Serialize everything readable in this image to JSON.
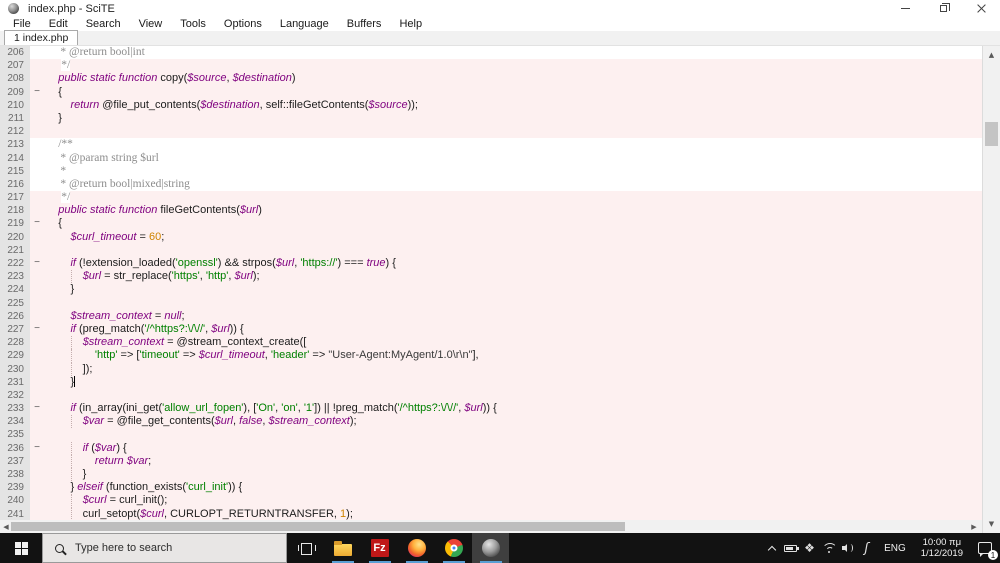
{
  "window": {
    "title": "index.php - SciTE"
  },
  "menu": [
    "File",
    "Edit",
    "Search",
    "View",
    "Tools",
    "Options",
    "Language",
    "Buffers",
    "Help"
  ],
  "tab": {
    "label": "1 index.php"
  },
  "editor": {
    "fold_char": "−",
    "lines": [
      {
        "n": 206,
        "bg": "c",
        "t": [
          [
            "cm",
            "     * @return bool|int"
          ]
        ]
      },
      {
        "n": 207,
        "t": [
          [
            "d",
            "     "
          ],
          [
            "cm",
            "*/"
          ]
        ]
      },
      {
        "n": 208,
        "t": [
          [
            "d",
            "    "
          ],
          [
            "k",
            "public"
          ],
          [
            "d",
            " "
          ],
          [
            "k",
            "static"
          ],
          [
            "d",
            " "
          ],
          [
            "k",
            "function"
          ],
          [
            "d",
            " copy("
          ],
          [
            "v",
            "$source"
          ],
          [
            "d",
            ", "
          ],
          [
            "v",
            "$destination"
          ],
          [
            "d",
            ")"
          ]
        ]
      },
      {
        "n": 209,
        "fold": true,
        "t": [
          [
            "d",
            "    {"
          ]
        ]
      },
      {
        "n": 210,
        "t": [
          [
            "d",
            "        "
          ],
          [
            "k",
            "return"
          ],
          [
            "d",
            " @file_put_contents("
          ],
          [
            "v",
            "$destination"
          ],
          [
            "d",
            ", self::fileGetContents("
          ],
          [
            "v",
            "$source"
          ],
          [
            "d",
            "));"
          ]
        ]
      },
      {
        "n": 211,
        "t": [
          [
            "d",
            "    }"
          ]
        ]
      },
      {
        "n": 212,
        "t": []
      },
      {
        "n": 213,
        "bg": "c",
        "t": [
          [
            "d",
            "    "
          ],
          [
            "cm",
            "/**"
          ]
        ]
      },
      {
        "n": 214,
        "bg": "c",
        "t": [
          [
            "cm",
            "     * @param string $url"
          ]
        ]
      },
      {
        "n": 215,
        "bg": "c",
        "t": [
          [
            "cm",
            "     *"
          ]
        ]
      },
      {
        "n": 216,
        "bg": "c",
        "t": [
          [
            "cm",
            "     * @return bool|mixed|string"
          ]
        ]
      },
      {
        "n": 217,
        "t": [
          [
            "d",
            "     "
          ],
          [
            "cm",
            "*/"
          ]
        ]
      },
      {
        "n": 218,
        "t": [
          [
            "d",
            "    "
          ],
          [
            "k",
            "public"
          ],
          [
            "d",
            " "
          ],
          [
            "k",
            "static"
          ],
          [
            "d",
            " "
          ],
          [
            "k",
            "function"
          ],
          [
            "d",
            " fileGetContents("
          ],
          [
            "v",
            "$url"
          ],
          [
            "d",
            ")"
          ]
        ]
      },
      {
        "n": 219,
        "fold": true,
        "t": [
          [
            "d",
            "    {"
          ]
        ]
      },
      {
        "n": 220,
        "t": [
          [
            "d",
            "        "
          ],
          [
            "v",
            "$curl_timeout"
          ],
          [
            "d",
            " = "
          ],
          [
            "n",
            "60"
          ],
          [
            "d",
            ";"
          ]
        ]
      },
      {
        "n": 221,
        "t": []
      },
      {
        "n": 222,
        "fold": true,
        "t": [
          [
            "d",
            "        "
          ],
          [
            "k",
            "if"
          ],
          [
            "d",
            " (!extension_loaded("
          ],
          [
            "s",
            "'openssl'"
          ],
          [
            "d",
            ") && strpos("
          ],
          [
            "v",
            "$url"
          ],
          [
            "d",
            ", "
          ],
          [
            "s",
            "'https://'"
          ],
          [
            "d",
            ") === "
          ],
          [
            "k",
            "true"
          ],
          [
            "d",
            ") {"
          ]
        ]
      },
      {
        "n": 223,
        "t": [
          [
            "d",
            "            "
          ],
          [
            "v",
            "$url"
          ],
          [
            "d",
            " = str_replace("
          ],
          [
            "s",
            "'https'"
          ],
          [
            "d",
            ", "
          ],
          [
            "s",
            "'http'"
          ],
          [
            "d",
            ", "
          ],
          [
            "v",
            "$url"
          ],
          [
            "d",
            ");"
          ]
        ]
      },
      {
        "n": 224,
        "t": [
          [
            "d",
            "        }"
          ]
        ]
      },
      {
        "n": 225,
        "t": []
      },
      {
        "n": 226,
        "t": [
          [
            "d",
            "        "
          ],
          [
            "v",
            "$stream_context"
          ],
          [
            "d",
            " = "
          ],
          [
            "k",
            "null"
          ],
          [
            "d",
            ";"
          ]
        ]
      },
      {
        "n": 227,
        "fold": true,
        "t": [
          [
            "d",
            "        "
          ],
          [
            "k",
            "if"
          ],
          [
            "d",
            " (preg_match("
          ],
          [
            "s",
            "'/^https?:\\/\\//'"
          ],
          [
            "d",
            ", "
          ],
          [
            "v",
            "$url"
          ],
          [
            "d",
            ")) {"
          ]
        ]
      },
      {
        "n": 228,
        "t": [
          [
            "d",
            "            "
          ],
          [
            "v",
            "$stream_context"
          ],
          [
            "d",
            " = @stream_context_create(["
          ]
        ]
      },
      {
        "n": 229,
        "t": [
          [
            "d",
            "                "
          ],
          [
            "s",
            "'http'"
          ],
          [
            "d",
            " => ["
          ],
          [
            "s",
            "'timeout'"
          ],
          [
            "d",
            " => "
          ],
          [
            "v",
            "$curl_timeout"
          ],
          [
            "d",
            ", "
          ],
          [
            "s",
            "'header'"
          ],
          [
            "d",
            " => "
          ],
          [
            "ds",
            "\"User-Agent:MyAgent/1.0\\r\\n\""
          ],
          [
            "d",
            "],"
          ]
        ]
      },
      {
        "n": 230,
        "t": [
          [
            "d",
            "            ]);"
          ]
        ]
      },
      {
        "n": 231,
        "caret": true,
        "t": [
          [
            "d",
            "        }"
          ]
        ]
      },
      {
        "n": 232,
        "t": []
      },
      {
        "n": 233,
        "fold": true,
        "t": [
          [
            "d",
            "        "
          ],
          [
            "k",
            "if"
          ],
          [
            "d",
            " (in_array(ini_get("
          ],
          [
            "s",
            "'allow_url_fopen'"
          ],
          [
            "d",
            "), ["
          ],
          [
            "s",
            "'On'"
          ],
          [
            "d",
            ", "
          ],
          [
            "s",
            "'on'"
          ],
          [
            "d",
            ", "
          ],
          [
            "s",
            "'1'"
          ],
          [
            "d",
            "]) || !preg_match("
          ],
          [
            "s",
            "'/^https?:\\/\\//'"
          ],
          [
            "d",
            ", "
          ],
          [
            "v",
            "$url"
          ],
          [
            "d",
            ")) {"
          ]
        ]
      },
      {
        "n": 234,
        "t": [
          [
            "d",
            "            "
          ],
          [
            "v",
            "$var"
          ],
          [
            "d",
            " = @file_get_contents("
          ],
          [
            "v",
            "$url"
          ],
          [
            "d",
            ", "
          ],
          [
            "k",
            "false"
          ],
          [
            "d",
            ", "
          ],
          [
            "v",
            "$stream_context"
          ],
          [
            "d",
            ");"
          ]
        ]
      },
      {
        "n": 235,
        "t": []
      },
      {
        "n": 236,
        "fold": true,
        "t": [
          [
            "d",
            "            "
          ],
          [
            "k",
            "if"
          ],
          [
            "d",
            " ("
          ],
          [
            "v",
            "$var"
          ],
          [
            "d",
            ") {"
          ]
        ]
      },
      {
        "n": 237,
        "t": [
          [
            "d",
            "                "
          ],
          [
            "k",
            "return"
          ],
          [
            "d",
            " "
          ],
          [
            "v",
            "$var"
          ],
          [
            "d",
            ";"
          ]
        ]
      },
      {
        "n": 238,
        "t": [
          [
            "d",
            "            }"
          ]
        ]
      },
      {
        "n": 239,
        "t": [
          [
            "d",
            "        } "
          ],
          [
            "k",
            "elseif"
          ],
          [
            "d",
            " (function_exists("
          ],
          [
            "s",
            "'curl_init'"
          ],
          [
            "d",
            ")) {"
          ]
        ]
      },
      {
        "n": 240,
        "t": [
          [
            "d",
            "            "
          ],
          [
            "v",
            "$curl"
          ],
          [
            "d",
            " = curl_init();"
          ]
        ]
      },
      {
        "n": 241,
        "t": [
          [
            "d",
            "            curl_setopt("
          ],
          [
            "v",
            "$curl"
          ],
          [
            "d",
            ", CURLOPT_RETURNTRANSFER, "
          ],
          [
            "n",
            "1"
          ],
          [
            "d",
            ");"
          ]
        ]
      }
    ]
  },
  "colors": {
    "editor_bg": "#fdf0f0",
    "comment_bg": "#ffffff",
    "keyword": "#7f007f",
    "string": "#008000",
    "number": "#cf8400",
    "taskbar_bg": "#121212",
    "taskbar_underline": "#5a9fd4"
  },
  "taskbar": {
    "search_placeholder": "Type here to search",
    "filezilla_label": "Fz",
    "language": "ENG",
    "clock_time": "10:00 πμ",
    "clock_date": "1/12/2019",
    "action_badge": "1"
  }
}
